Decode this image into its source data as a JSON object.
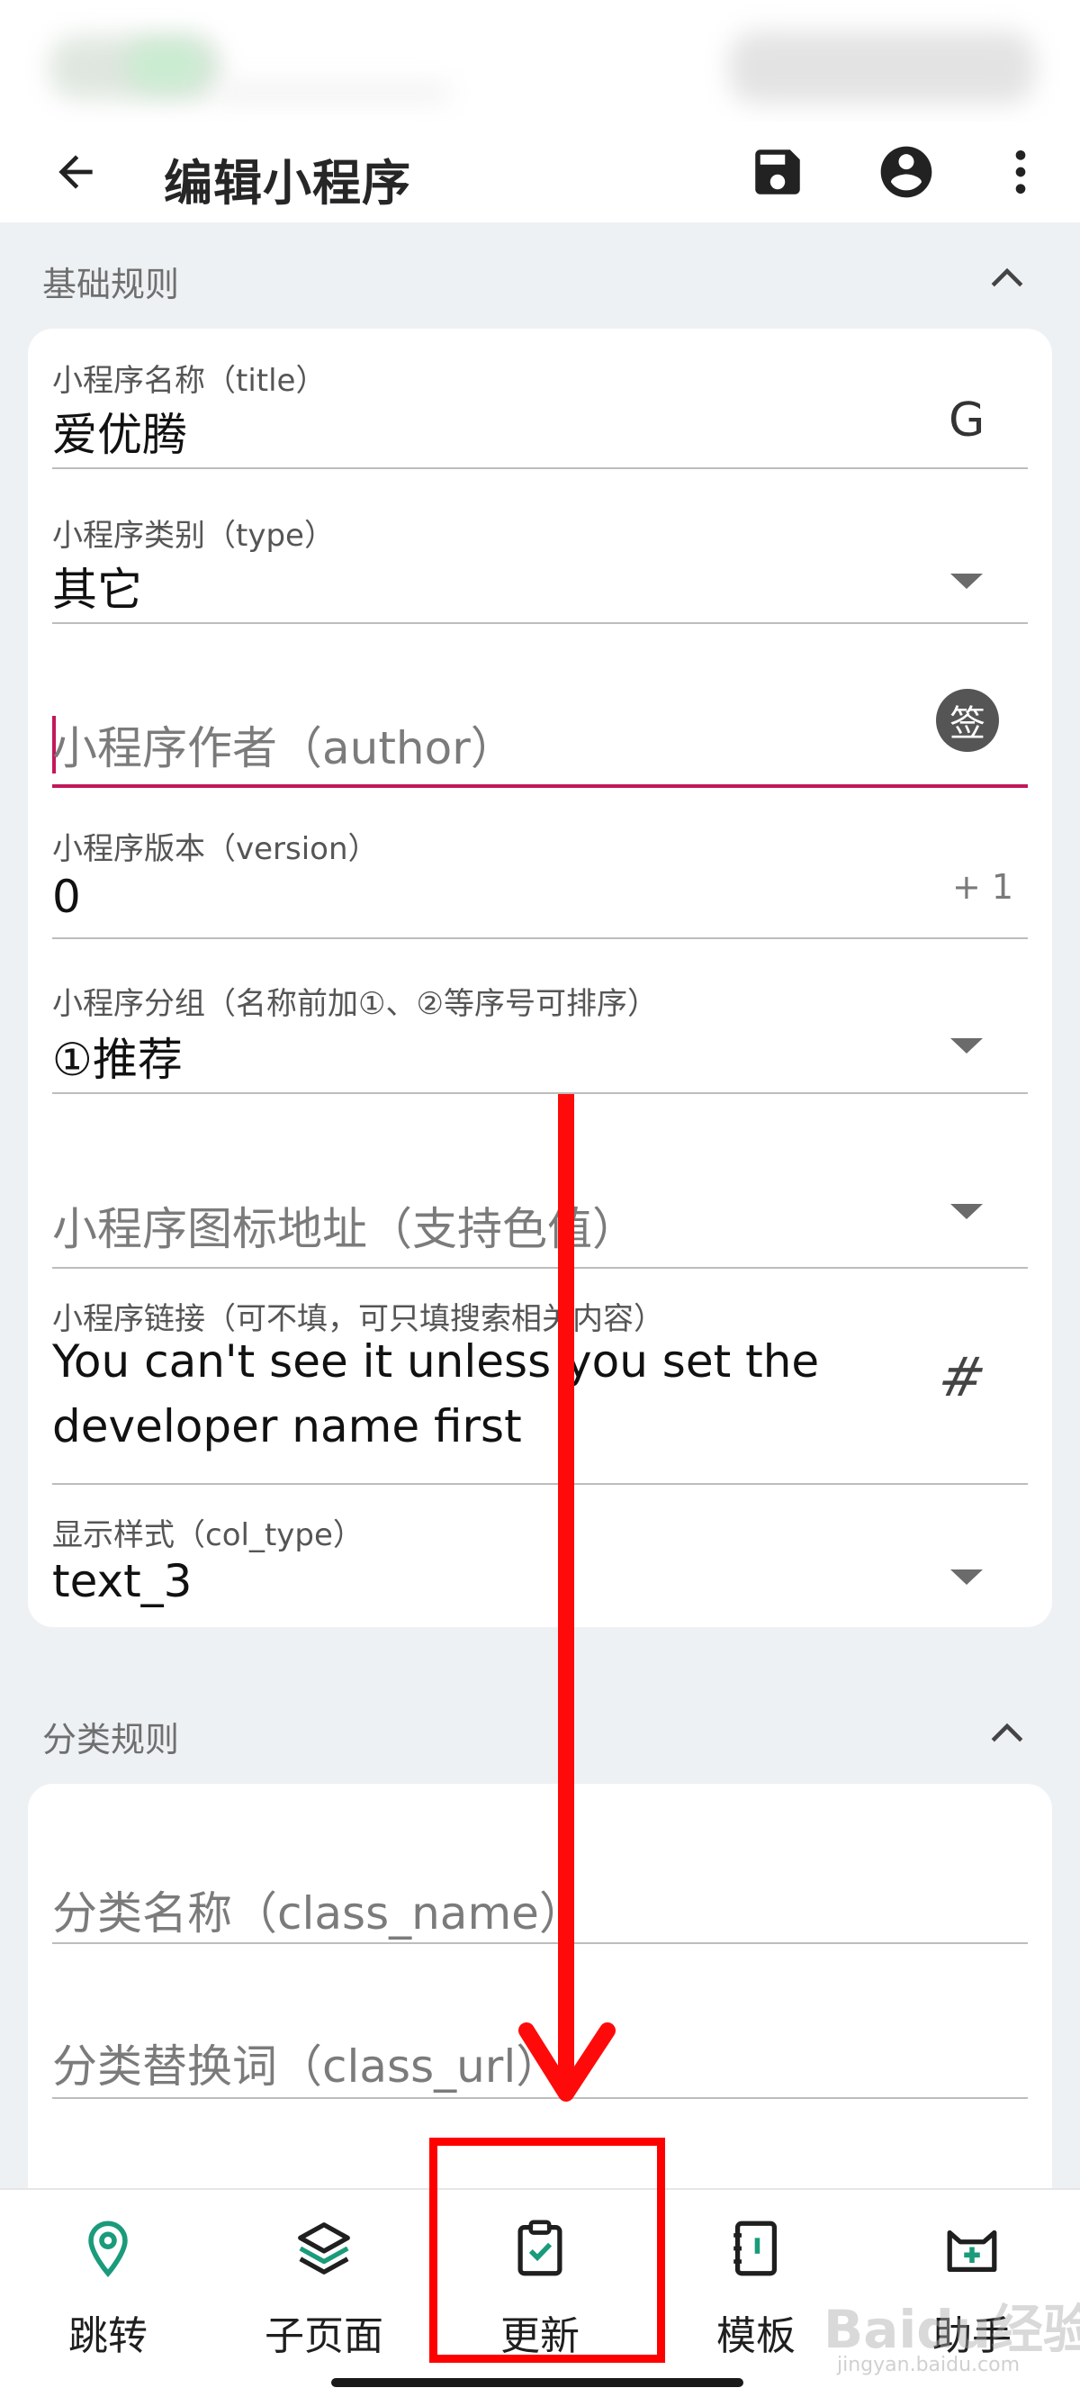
{
  "app_bar": {
    "title": "编辑小程序",
    "icons": [
      "arrow-back-icon",
      "save-icon",
      "account-circle-icon",
      "more-vert-icon"
    ]
  },
  "sections": {
    "basic": {
      "title": "基础规则"
    },
    "category": {
      "title": "分类规则"
    }
  },
  "fields": {
    "title": {
      "label": "小程序名称（title）",
      "value": "爱优腾",
      "suffix": "G"
    },
    "type": {
      "label": "小程序类别（type）",
      "value": "其它"
    },
    "author": {
      "placeholder": "小程序作者（author）",
      "suffix": "签"
    },
    "version": {
      "label": "小程序版本（version）",
      "value": "0",
      "suffix": "+ 1"
    },
    "group": {
      "label": "小程序分组（名称前加①、②等序号可排序）",
      "value": "①推荐"
    },
    "icon_url": {
      "placeholder": "小程序图标地址（支持色值）"
    },
    "link": {
      "label": "小程序链接（可不填，可只填搜索相关内容）",
      "value_line1": "You can't see it unless you set the",
      "value_line2": "developer name first",
      "suffix": "#"
    },
    "col_type": {
      "label": "显示样式（col_type）",
      "value": "text_3"
    },
    "class_name": {
      "placeholder": "分类名称（class_name）"
    },
    "class_url": {
      "placeholder": "分类替换词（class_url）"
    }
  },
  "bottom_nav": {
    "items": [
      {
        "label": "跳转",
        "icon": "location-pin-icon"
      },
      {
        "label": "子页面",
        "icon": "layers-icon"
      },
      {
        "label": "更新",
        "icon": "clipboard-check-icon"
      },
      {
        "label": "模板",
        "icon": "notebook-icon"
      },
      {
        "label": "助手",
        "icon": "cat-plus-icon"
      }
    ]
  },
  "annotation": {
    "watermark": "Baidu经验",
    "watermark_sub": "jingyan.baidu.com"
  },
  "colors": {
    "accent": "#c2185b",
    "highlight": "#ff0000",
    "teal": "#1a9b7b",
    "background": "#eef1f4"
  }
}
